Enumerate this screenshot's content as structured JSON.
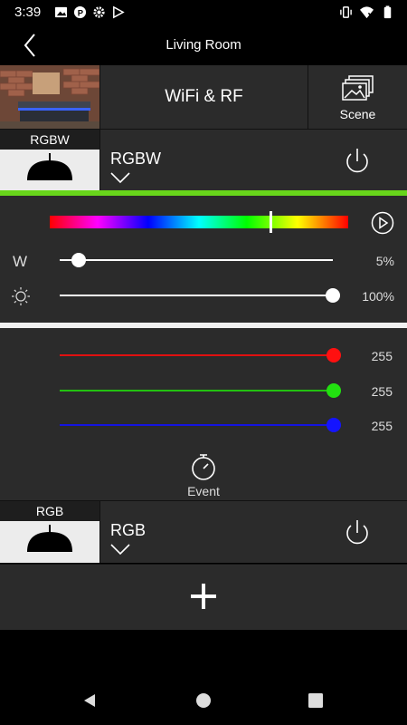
{
  "status_bar": {
    "time": "3:39",
    "icons_left": [
      "image-icon",
      "p-app-icon",
      "gear-icon",
      "play-store-icon"
    ],
    "icons_right": [
      "vibrate-icon",
      "wifi-icon",
      "battery-icon"
    ]
  },
  "header": {
    "title": "Living Room"
  },
  "top_row": {
    "controller_label": "WiFi & RF",
    "scene_label": "Scene"
  },
  "device_1": {
    "lamp_tag": "RGBW",
    "name": "RGBW"
  },
  "color_panel": {
    "hue_position": 0.74,
    "white_label": "W",
    "white_value": "5%",
    "white_level": 0.05,
    "brightness_value": "100%",
    "brightness_level": 1.0
  },
  "rgb_panel": {
    "red_value": "255",
    "green_value": "255",
    "blue_value": "255",
    "colors": {
      "red": "#ff1010",
      "green": "#22e010",
      "blue": "#1414ff"
    }
  },
  "event": {
    "label": "Event"
  },
  "device_2": {
    "lamp_tag": "RGB",
    "name": "RGB"
  },
  "accent": {
    "green_line": "#68d51b"
  }
}
